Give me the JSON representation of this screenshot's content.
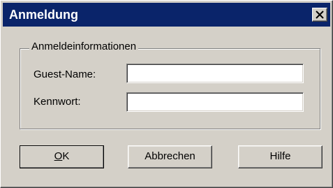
{
  "dialog": {
    "title": "Anmeldung"
  },
  "group": {
    "label": "Anmeldeinformationen",
    "fields": [
      {
        "label": "Guest-Name:",
        "value": "",
        "type": "text"
      },
      {
        "label": "Kennwort:",
        "value": "",
        "type": "password"
      }
    ]
  },
  "buttons": {
    "ok": {
      "accel": "O",
      "rest": "K"
    },
    "cancel": "Abbrechen",
    "help": "Hilfe"
  },
  "icons": {
    "close": "close-icon"
  },
  "colors": {
    "titlebar": "#0a246a",
    "face": "#d4d0c8",
    "title_text": "#ffffff"
  }
}
